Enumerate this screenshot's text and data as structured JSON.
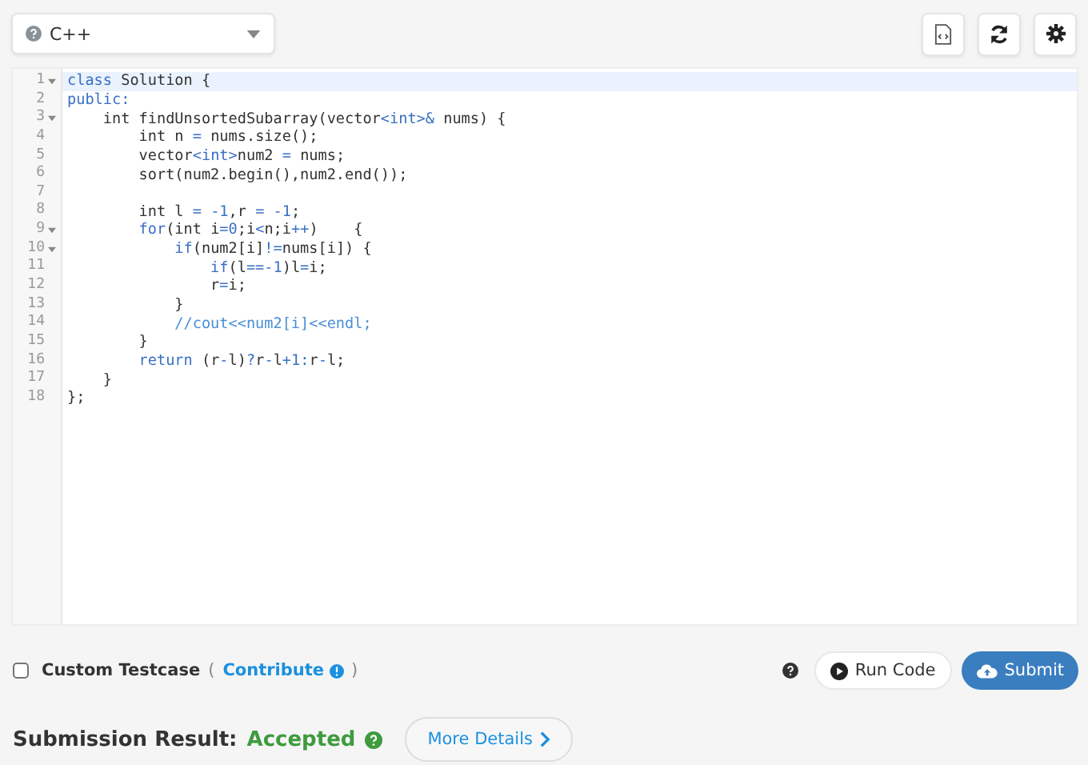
{
  "language_select": {
    "value": "C++"
  },
  "toolbar_buttons": [
    {
      "kind": "file"
    },
    {
      "kind": "reset"
    },
    {
      "kind": "settings"
    }
  ],
  "editor": {
    "lines": [
      {
        "number": "1",
        "fold": true,
        "active": true,
        "segments": [
          {
            "kind": "kw",
            "text": "class"
          },
          {
            "kind": "txt",
            "text": " Solution {"
          }
        ]
      },
      {
        "number": "2",
        "fold": false,
        "active": false,
        "segments": [
          {
            "kind": "kw",
            "text": "public:"
          }
        ]
      },
      {
        "number": "3",
        "fold": true,
        "active": false,
        "segments": [
          {
            "kind": "txt",
            "text": "    int findUnsortedSubarray(vector"
          },
          {
            "kind": "kw",
            "text": "<int>&"
          },
          {
            "kind": "txt",
            "text": " nums) {"
          }
        ]
      },
      {
        "number": "4",
        "fold": false,
        "active": false,
        "segments": [
          {
            "kind": "txt",
            "text": "        int n "
          },
          {
            "kind": "kw",
            "text": "="
          },
          {
            "kind": "txt",
            "text": " nums.size();"
          }
        ]
      },
      {
        "number": "5",
        "fold": false,
        "active": false,
        "segments": [
          {
            "kind": "txt",
            "text": "        vector"
          },
          {
            "kind": "kw",
            "text": "<int>"
          },
          {
            "kind": "txt",
            "text": "num2 "
          },
          {
            "kind": "kw",
            "text": "="
          },
          {
            "kind": "txt",
            "text": " nums;"
          }
        ]
      },
      {
        "number": "6",
        "fold": false,
        "active": false,
        "segments": [
          {
            "kind": "txt",
            "text": "        sort(num2.begin(),num2.end());"
          }
        ]
      },
      {
        "number": "7",
        "fold": false,
        "active": false
      },
      {
        "number": "8",
        "fold": false,
        "active": false,
        "segments": [
          {
            "kind": "txt",
            "text": "        int l "
          },
          {
            "kind": "kw",
            "text": "= -1"
          },
          {
            "kind": "txt",
            "text": ",r "
          },
          {
            "kind": "kw",
            "text": "= -1"
          },
          {
            "kind": "txt",
            "text": ";"
          }
        ]
      },
      {
        "number": "9",
        "fold": true,
        "active": false,
        "segments": [
          {
            "kind": "kw",
            "text": "        for"
          },
          {
            "kind": "txt",
            "text": "(int i"
          },
          {
            "kind": "kw",
            "text": "=0"
          },
          {
            "kind": "txt",
            "text": ";i"
          },
          {
            "kind": "kw",
            "text": "<"
          },
          {
            "kind": "txt",
            "text": "n;i"
          },
          {
            "kind": "kw",
            "text": "++"
          },
          {
            "kind": "txt",
            "text": ")    {"
          }
        ]
      },
      {
        "number": "10",
        "fold": true,
        "active": false,
        "segments": [
          {
            "kind": "kw",
            "text": "            if"
          },
          {
            "kind": "txt",
            "text": "(num2[i]"
          },
          {
            "kind": "kw",
            "text": "!="
          },
          {
            "kind": "txt",
            "text": "nums[i]) {"
          }
        ]
      },
      {
        "number": "11",
        "fold": false,
        "active": false,
        "segments": [
          {
            "kind": "kw",
            "text": "                if"
          },
          {
            "kind": "txt",
            "text": "(l"
          },
          {
            "kind": "kw",
            "text": "==-1"
          },
          {
            "kind": "txt",
            "text": ")l"
          },
          {
            "kind": "kw",
            "text": "="
          },
          {
            "kind": "txt",
            "text": "i;"
          }
        ]
      },
      {
        "number": "12",
        "fold": false,
        "active": false,
        "segments": [
          {
            "kind": "txt",
            "text": "                r"
          },
          {
            "kind": "kw",
            "text": "="
          },
          {
            "kind": "txt",
            "text": "i;"
          }
        ]
      },
      {
        "number": "13",
        "fold": false,
        "active": false,
        "segments": [
          {
            "kind": "txt",
            "text": "            }"
          }
        ]
      },
      {
        "number": "14",
        "fold": false,
        "active": false,
        "segments": [
          {
            "kind": "comment",
            "text": "            //cout<<num2[i]<<endl;"
          }
        ]
      },
      {
        "number": "15",
        "fold": false,
        "active": false,
        "segments": [
          {
            "kind": "txt",
            "text": "        }"
          }
        ]
      },
      {
        "number": "16",
        "fold": false,
        "active": false,
        "segments": [
          {
            "kind": "kw",
            "text": "        return"
          },
          {
            "kind": "txt",
            "text": " (r"
          },
          {
            "kind": "kw",
            "text": "-"
          },
          {
            "kind": "txt",
            "text": "l)"
          },
          {
            "kind": "kw",
            "text": "?"
          },
          {
            "kind": "txt",
            "text": "r"
          },
          {
            "kind": "kw",
            "text": "-"
          },
          {
            "kind": "txt",
            "text": "l"
          },
          {
            "kind": "kw",
            "text": "+1:"
          },
          {
            "kind": "txt",
            "text": "r"
          },
          {
            "kind": "kw",
            "text": "-"
          },
          {
            "kind": "txt",
            "text": "l;"
          }
        ]
      },
      {
        "number": "17",
        "fold": false,
        "active": false,
        "segments": [
          {
            "kind": "txt",
            "text": "    }"
          }
        ]
      },
      {
        "number": "18",
        "fold": false,
        "active": false,
        "segments": [
          {
            "kind": "txt",
            "text": "};"
          }
        ]
      }
    ]
  },
  "custom_testcase": {
    "label": "Custom Testcase",
    "checked": false,
    "open_paren": "(",
    "link": "Contribute",
    "close_paren": ")"
  },
  "actions": {
    "run": "Run Code",
    "submit": "Submit"
  },
  "result": {
    "label": "Submission Result:",
    "status": "Accepted",
    "details_button": "More Details"
  }
}
